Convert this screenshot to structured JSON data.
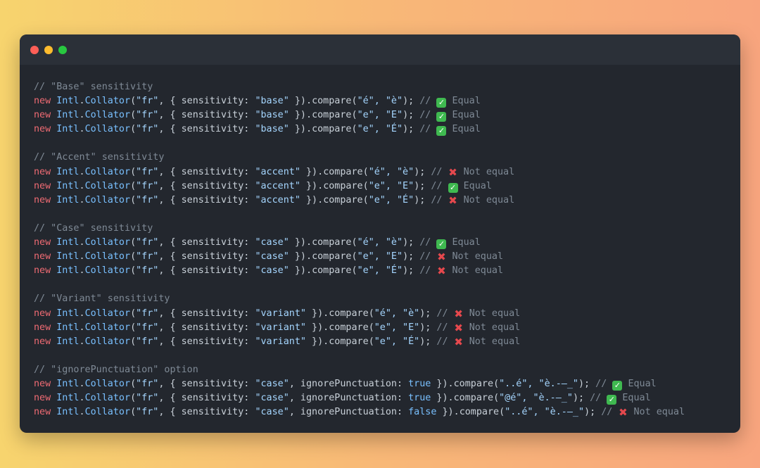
{
  "colors": {
    "window_bg": "#23272e",
    "titlebar_bg": "#2b3038",
    "keyword": "#ef6b73",
    "class": "#79c0ff",
    "string": "#a5d6ff",
    "comment": "#7f8a96"
  },
  "window_controls": [
    "close",
    "minimize",
    "zoom"
  ],
  "code": {
    "sections": [
      {
        "comment": "// \"Base\" sensitivity",
        "lines": [
          {
            "sensitivity": "\"base\"",
            "extra": "",
            "args": "\"é\", \"è\"",
            "icon": "check-icon",
            "result": "Equal"
          },
          {
            "sensitivity": "\"base\"",
            "extra": "",
            "args": "\"e\", \"E\"",
            "icon": "check-icon",
            "result": "Equal"
          },
          {
            "sensitivity": "\"base\"",
            "extra": "",
            "args": "\"e\", \"É\"",
            "icon": "check-icon",
            "result": "Equal"
          }
        ]
      },
      {
        "comment": "// \"Accent\" sensitivity",
        "lines": [
          {
            "sensitivity": "\"accent\"",
            "extra": "",
            "args": "\"é\", \"è\"",
            "icon": "cross-icon",
            "result": "Not equal"
          },
          {
            "sensitivity": "\"accent\"",
            "extra": "",
            "args": "\"e\", \"E\"",
            "icon": "check-icon",
            "result": "Equal"
          },
          {
            "sensitivity": "\"accent\"",
            "extra": "",
            "args": "\"e\", \"É\"",
            "icon": "cross-icon",
            "result": "Not equal"
          }
        ]
      },
      {
        "comment": "// \"Case\" sensitivity",
        "lines": [
          {
            "sensitivity": "\"case\"",
            "extra": "",
            "args": "\"é\", \"è\"",
            "icon": "check-icon",
            "result": "Equal"
          },
          {
            "sensitivity": "\"case\"",
            "extra": "",
            "args": "\"e\", \"E\"",
            "icon": "cross-icon",
            "result": "Not equal"
          },
          {
            "sensitivity": "\"case\"",
            "extra": "",
            "args": "\"e\", \"É\"",
            "icon": "cross-icon",
            "result": "Not equal"
          }
        ]
      },
      {
        "comment": "// \"Variant\" sensitivity",
        "lines": [
          {
            "sensitivity": "\"variant\"",
            "extra": "",
            "args": "\"é\", \"è\"",
            "icon": "cross-icon",
            "result": "Not equal"
          },
          {
            "sensitivity": "\"variant\"",
            "extra": "",
            "args": "\"e\", \"E\"",
            "icon": "cross-icon",
            "result": "Not equal"
          },
          {
            "sensitivity": "\"variant\"",
            "extra": "",
            "args": "\"e\", \"É\"",
            "icon": "cross-icon",
            "result": "Not equal"
          }
        ]
      },
      {
        "comment": "// \"ignorePunctuation\" option",
        "lines": [
          {
            "sensitivity": "\"case\"",
            "extra": "true",
            "args": "\"..é\", \"è.-—_\"",
            "icon": "check-icon",
            "result": "Equal"
          },
          {
            "sensitivity": "\"case\"",
            "extra": "true",
            "args": "\"@é\", \"è.-—_\"",
            "icon": "check-icon",
            "result": "Equal"
          },
          {
            "sensitivity": "\"case\"",
            "extra": "false",
            "args": "\"..é\", \"è.-—_\"",
            "icon": "cross-icon",
            "result": "Not equal"
          }
        ]
      }
    ],
    "tokens": {
      "new": "new",
      "intl": "Intl",
      "dot": ".",
      "collator": "Collator",
      "open": "(",
      "locale": "\"fr\"",
      "obj_open": ", { ",
      "sens_key": "sensitivity: ",
      "ignore_key": ", ignorePunctuation: ",
      "obj_close": " }).",
      "compare": "compare",
      "close": ");",
      "comment_slashes": " // "
    }
  }
}
